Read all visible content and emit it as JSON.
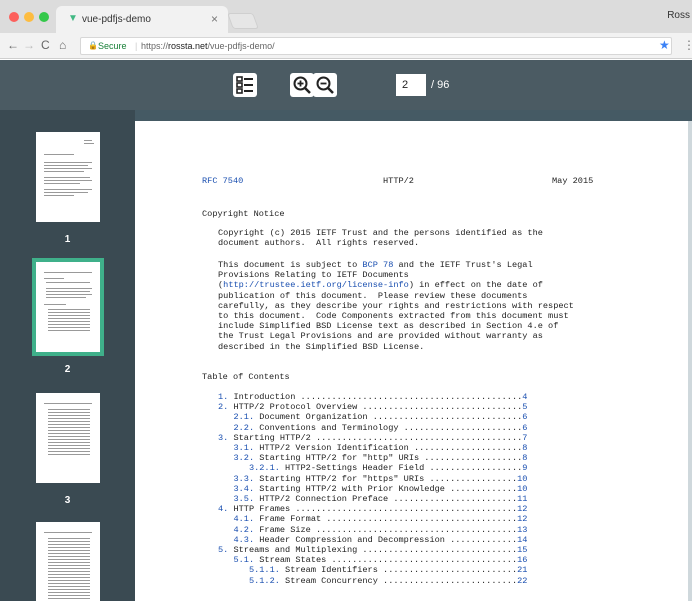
{
  "browser": {
    "tab_title": "vue-pdfjs-demo",
    "tab_close": "×",
    "profile": "Ross",
    "secure_label": "Secure",
    "url_scheme": "https://",
    "url_host": "rossta.net",
    "url_path": "/vue-pdfjs-demo/",
    "nav": {
      "back": "←",
      "forward": "→",
      "reload": "C",
      "home": "⌂"
    },
    "star": "★",
    "menu": "⋮"
  },
  "toolbar": {
    "current_page": "2",
    "total_pages": "/ 96"
  },
  "thumbnails": [
    {
      "number": "1"
    },
    {
      "number": "2"
    },
    {
      "number": "3"
    }
  ],
  "document": {
    "header": {
      "left": "RFC 7540",
      "center": "HTTP/2",
      "right": "May 2015"
    },
    "copyright_heading": "Copyright Notice",
    "copyright_lines": [
      "Copyright (c) 2015 IETF Trust and the persons identified as the",
      "document authors.  All rights reserved."
    ],
    "body_lines": [
      {
        "before": "This document is subject to ",
        "link": "BCP 78",
        "after": " and the IETF Trust's Legal"
      },
      {
        "before": "Provisions Relating to IETF Documents",
        "link": "",
        "after": ""
      },
      {
        "before": "(",
        "link": "http://trustee.ietf.org/license-info",
        "after": ") in effect on the date of"
      },
      {
        "before": "publication of this document.  Please review these documents",
        "link": "",
        "after": ""
      },
      {
        "before": "carefully, as they describe your rights and restrictions with respect",
        "link": "",
        "after": ""
      },
      {
        "before": "to this document.  Code Components extracted from this document must",
        "link": "",
        "after": ""
      },
      {
        "before": "include Simplified BSD License text as described in Section 4.e of",
        "link": "",
        "after": ""
      },
      {
        "before": "the Trust Legal Provisions and are provided without warranty as",
        "link": "",
        "after": ""
      },
      {
        "before": "described in the Simplified BSD License.",
        "link": "",
        "after": ""
      }
    ],
    "toc_heading": "Table of Contents",
    "toc": [
      {
        "indent": 0,
        "num": "1.",
        "title": "Introduction",
        "page": "4"
      },
      {
        "indent": 0,
        "num": "2.",
        "title": "HTTP/2 Protocol Overview",
        "page": "5"
      },
      {
        "indent": 1,
        "num": "2.1.",
        "title": "Document Organization",
        "page": "6"
      },
      {
        "indent": 1,
        "num": "2.2.",
        "title": "Conventions and Terminology",
        "page": "6"
      },
      {
        "indent": 0,
        "num": "3.",
        "title": "Starting HTTP/2",
        "page": "7"
      },
      {
        "indent": 1,
        "num": "3.1.",
        "title": "HTTP/2 Version Identification",
        "page": "8"
      },
      {
        "indent": 1,
        "num": "3.2.",
        "title": "Starting HTTP/2 for \"http\" URIs",
        "page": "8"
      },
      {
        "indent": 2,
        "num": "3.2.1.",
        "title": "HTTP2-Settings Header Field",
        "page": "9"
      },
      {
        "indent": 1,
        "num": "3.3.",
        "title": "Starting HTTP/2 for \"https\" URIs",
        "page": "10"
      },
      {
        "indent": 1,
        "num": "3.4.",
        "title": "Starting HTTP/2 with Prior Knowledge",
        "page": "10"
      },
      {
        "indent": 1,
        "num": "3.5.",
        "title": "HTTP/2 Connection Preface",
        "page": "11"
      },
      {
        "indent": 0,
        "num": "4.",
        "title": "HTTP Frames",
        "page": "12"
      },
      {
        "indent": 1,
        "num": "4.1.",
        "title": "Frame Format",
        "page": "12"
      },
      {
        "indent": 1,
        "num": "4.2.",
        "title": "Frame Size",
        "page": "13"
      },
      {
        "indent": 1,
        "num": "4.3.",
        "title": "Header Compression and Decompression",
        "page": "14"
      },
      {
        "indent": 0,
        "num": "5.",
        "title": "Streams and Multiplexing",
        "page": "15"
      },
      {
        "indent": 1,
        "num": "5.1.",
        "title": "Stream States",
        "page": "16"
      },
      {
        "indent": 2,
        "num": "5.1.1.",
        "title": "Stream Identifiers",
        "page": "21"
      },
      {
        "indent": 2,
        "num": "5.1.2.",
        "title": "Stream Concurrency",
        "page": "22"
      }
    ]
  },
  "colors": {
    "toolbar": "#4b5b63",
    "sidebar": "#3a4a52",
    "selected_thumb": "#3fb08a",
    "link": "#1a4fb0"
  }
}
